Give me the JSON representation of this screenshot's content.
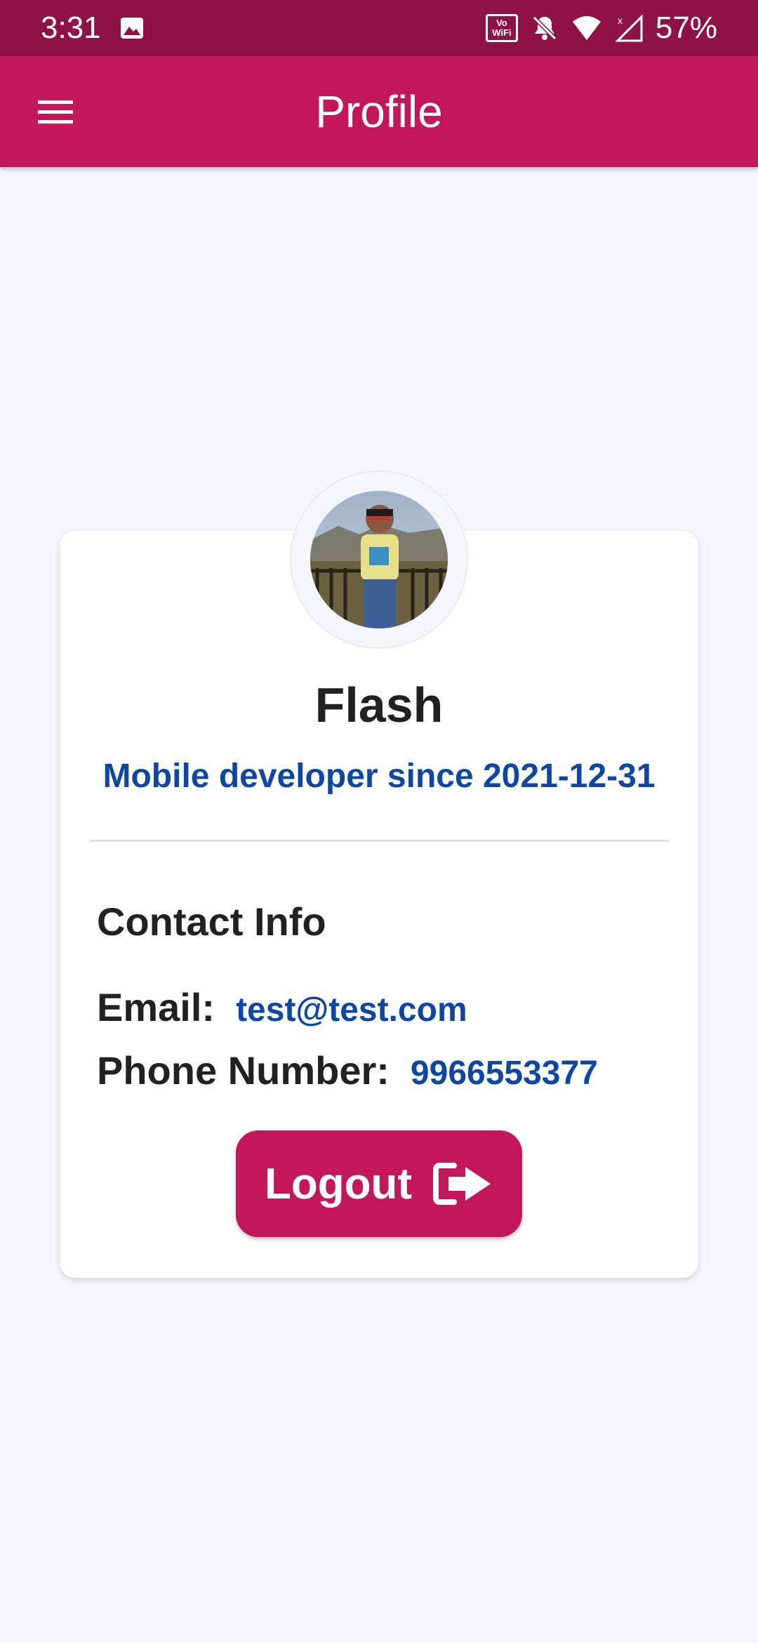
{
  "status_bar": {
    "time": "3:31",
    "battery": "57%",
    "vowifi_top": "Vo",
    "vowifi_bottom": "WiFi",
    "icons": [
      "image-icon",
      "vowifi-icon",
      "bell-off-icon",
      "wifi-icon",
      "signal-icon"
    ]
  },
  "app_bar": {
    "title": "Profile",
    "menu_icon": "menu-icon"
  },
  "profile": {
    "name": "Flash",
    "subtitle": "Mobile developer since 2021-12-31"
  },
  "contact": {
    "title": "Contact Info",
    "email_label": "Email:",
    "email_value": "test@test.com",
    "phone_label": "Phone Number:",
    "phone_value": "9966553377"
  },
  "logout": {
    "label": "Logout",
    "icon": "logout-icon"
  },
  "colors": {
    "status_bar": "#8e1244",
    "primary": "#c2185b",
    "accent_text": "#0d47a1",
    "background": "#f5f6fb",
    "card": "#ffffff"
  }
}
